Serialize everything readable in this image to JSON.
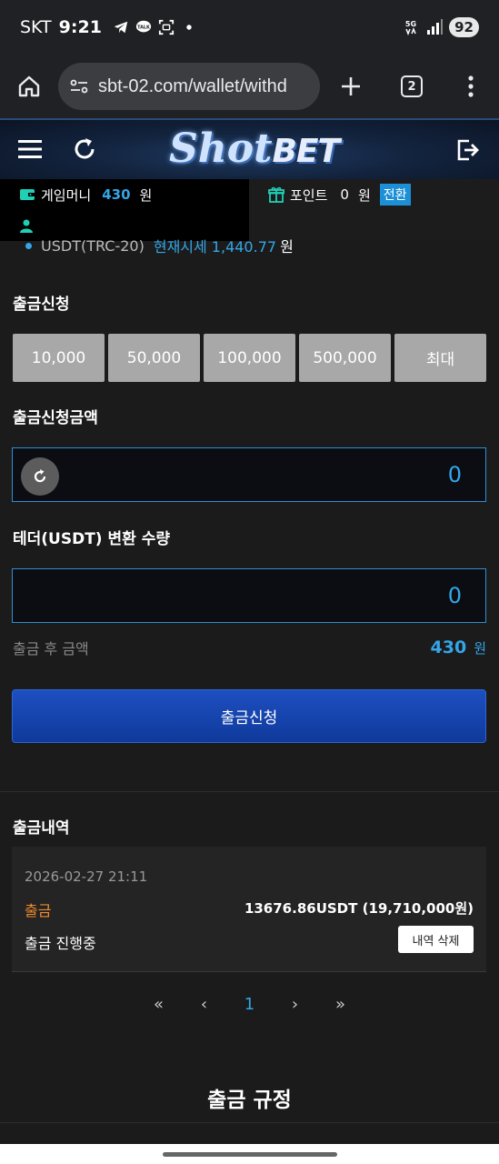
{
  "status_bar": {
    "carrier": "SKT",
    "time": "9:21",
    "network": "5G",
    "battery": "92"
  },
  "browser": {
    "url": "sbt-02.com/wallet/withd",
    "tab_count": "2"
  },
  "site": {
    "logo_shot": "Shot",
    "logo_bet": "BET"
  },
  "wallet": {
    "game_money_label": "게임머니",
    "game_money_value": "430",
    "game_money_unit": "원",
    "point_label": "포인트",
    "point_value": "0",
    "point_unit": "원",
    "convert_label": "전환"
  },
  "rate": {
    "currency": "USDT(TRC-20)",
    "rate_text": "현재시세 1,440.77",
    "unit": "원"
  },
  "withdraw_request": {
    "title": "출금신청",
    "quick_amounts": [
      "10,000",
      "50,000",
      "100,000",
      "500,000",
      "최대"
    ]
  },
  "amount": {
    "label": "출금신청금액",
    "value": "0"
  },
  "usdt": {
    "label": "테더(USDT) 변환 수량",
    "value": "0"
  },
  "after": {
    "label": "출금 후 금액",
    "value": "430",
    "unit": "원"
  },
  "submit_label": "출금신청",
  "history": {
    "title": "출금내역",
    "items": [
      {
        "date": "2026-02-27 21:11",
        "type": "출금",
        "amount": "13676.86USDT (19,710,000원)",
        "status": "출금 진행중",
        "delete_label": "내역 삭제"
      }
    ]
  },
  "pagination": {
    "first": "«",
    "prev": "‹",
    "current": "1",
    "next": "›",
    "last": "»"
  },
  "rules_title": "출금 규정"
}
